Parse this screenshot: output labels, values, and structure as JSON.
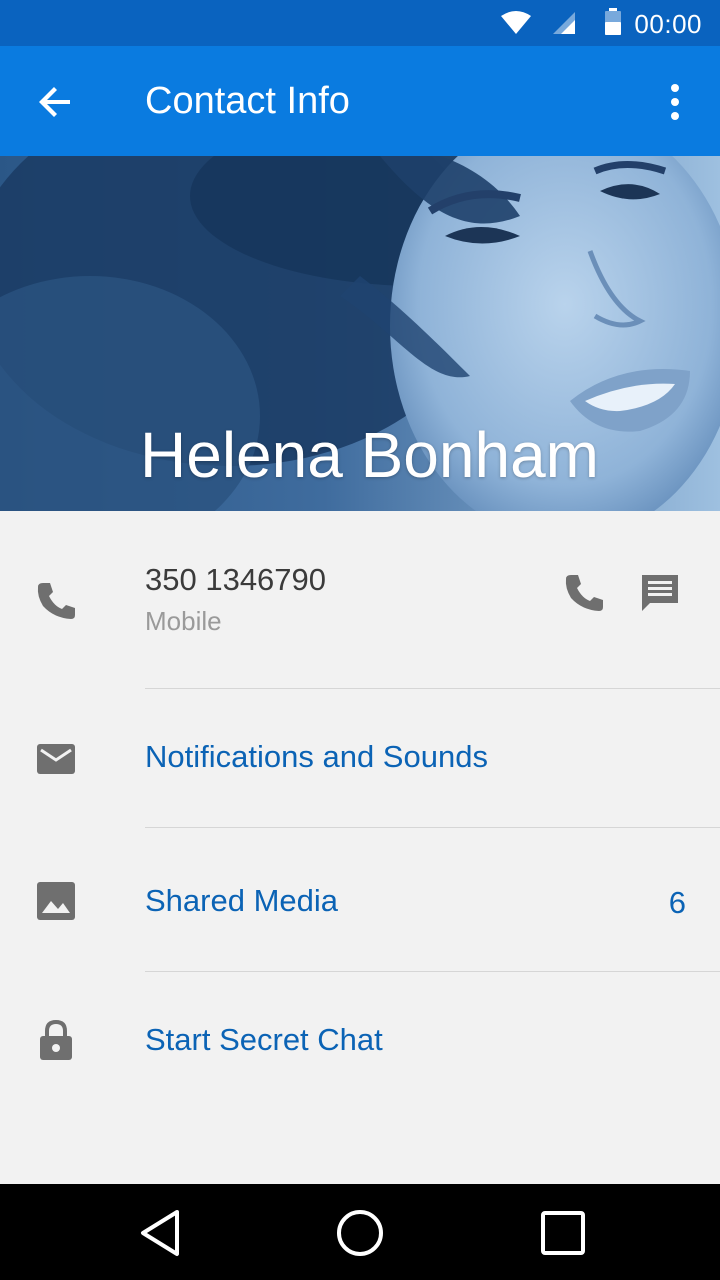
{
  "status_bar": {
    "time": "00:00",
    "icons": [
      "wifi-icon",
      "cellular-signal-icon",
      "battery-icon"
    ]
  },
  "app_bar": {
    "title": "Contact Info",
    "back_icon": "arrow-back-icon",
    "menu_icon": "more-vert-icon"
  },
  "contact": {
    "name": "Helena Bonham"
  },
  "phone": {
    "number": "350 1346790",
    "type": "Mobile",
    "icons": [
      "phone-icon",
      "call-icon",
      "message-icon"
    ]
  },
  "menu": {
    "notifications": "Notifications and Sounds",
    "shared_media": "Shared Media",
    "shared_media_count": "6",
    "secret_chat": "Start Secret Chat"
  },
  "colors": {
    "status_bar": "#0a63bf",
    "app_bar": "#0a7be0",
    "link": "#0b63b5",
    "background": "#f2f2f2"
  },
  "nav_bar": {
    "icons": [
      "back-triangle-icon",
      "home-circle-icon",
      "recents-square-icon"
    ]
  }
}
